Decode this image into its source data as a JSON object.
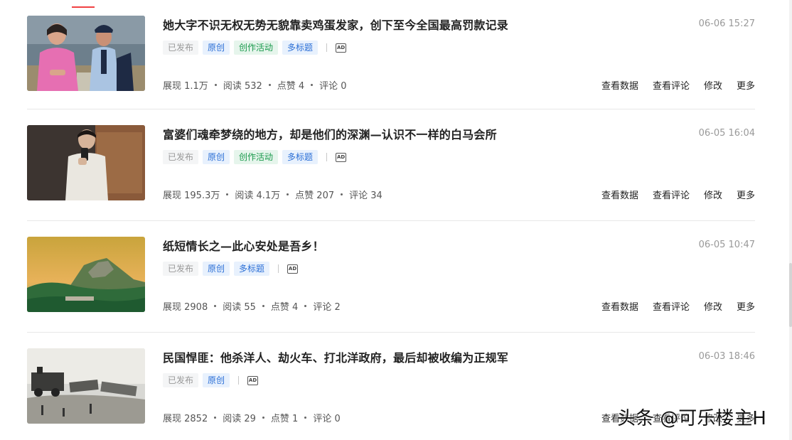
{
  "articles": [
    {
      "title": "她大字不识无权无势无貌靠卖鸡蛋发家，创下至今全国最高罚款记录",
      "time": "06-06 15:27",
      "tags": [
        "已发布",
        "原创",
        "创作活动",
        "多标题"
      ],
      "stats": [
        "展现 1.1万",
        "阅读 532",
        "点赞 4",
        "评论 0"
      ],
      "image": "woman-in-court-photo"
    },
    {
      "title": "富婆们魂牵梦绕的地方，却是他们的深渊—认识不一样的白马会所",
      "time": "06-05 16:04",
      "tags": [
        "已发布",
        "原创",
        "创作活动",
        "多标题"
      ],
      "stats": [
        "展现 195.3万",
        "阅读 4.1万",
        "点赞 207",
        "评论 34"
      ],
      "image": "man-mirror-selfie-photo"
    },
    {
      "title": "纸短情长之—此心安处是吾乡！",
      "time": "06-05 10:47",
      "tags": [
        "已发布",
        "原创",
        "多标题"
      ],
      "stats": [
        "展现 2908",
        "阅读 55",
        "点赞 4",
        "评论 2"
      ],
      "image": "mountain-landscape-photo"
    },
    {
      "title": "民国悍匪：他杀洋人、劫火车、打北洋政府，最后却被收编为正规军",
      "time": "06-03 18:46",
      "tags": [
        "已发布",
        "原创"
      ],
      "stats": [
        "展现 2852",
        "阅读 29",
        "点赞 1",
        "评论 0"
      ],
      "image": "train-wreck-historic-photo"
    }
  ],
  "actions": [
    "查看数据",
    "查看评论",
    "修改",
    "更多"
  ],
  "ad_label": "AD",
  "watermark": "头条 @可乐楼主H",
  "colors": {
    "accent": "#f04142",
    "tag_blue": "#2b6fd6",
    "tag_green": "#1a9a4c",
    "tag_gray": "#999999"
  }
}
